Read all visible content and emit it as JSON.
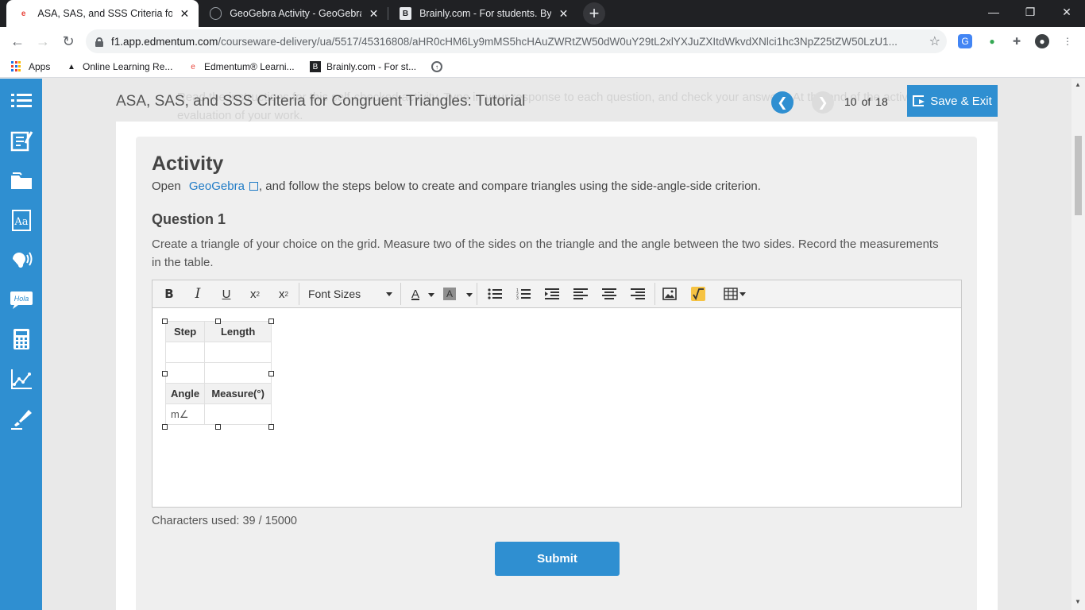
{
  "browser": {
    "tabs": [
      {
        "title": "ASA, SAS, and SSS Criteria for Co",
        "favicon": "e"
      },
      {
        "title": "GeoGebra Activity - GeoGebra Dy",
        "favicon": "g"
      },
      {
        "title": "Brainly.com - For students. By stu",
        "favicon": "B"
      }
    ],
    "url_domain": "f1.app.edmentum.com",
    "url_path": "/courseware-delivery/ua/5517/45316808/aHR0cHM6Ly9mMS5hcHAuZWRtZW50dW0uY29tL2xlYXJuZXItdWkvdXNlci1hc3NpZ25tZW50LzU1...",
    "bookmarks": [
      "Apps",
      "Online Learning Re...",
      "Edmentum® Learni...",
      "Brainly.com - For st..."
    ]
  },
  "header": {
    "lesson_title": "ASA, SAS, and SSS Criteria for Congruent Triangles: Tutorial",
    "ghost_text": "Read the instructions for this self-checked activity. Type in your response to each question, and check your answers. At the end of the activity, write a brief evaluation of your work.",
    "page_current": "10",
    "page_of": "of",
    "page_total": "18",
    "save_exit": "Save & Exit"
  },
  "activity": {
    "heading": "Activity",
    "intro_before": "Open",
    "intro_link": "GeoGebra",
    "intro_after": ", and follow the steps below to create and compare triangles using the side-angle-side criterion.",
    "question_heading": "Question 1",
    "prompt": "Create a triangle of your choice on the grid. Measure two of the sides on the triangle and the angle between the two sides. Record the measurements in the table."
  },
  "editor": {
    "font_sizes": "Font Sizes",
    "table": {
      "side_headers": [
        "Step",
        "Length"
      ],
      "angle_headers": [
        "Angle",
        "Measure(°)"
      ],
      "angle_prefix": "m∠"
    },
    "chars_used": "Characters used: 39 / 15000"
  },
  "submit_label": "Submit",
  "colors": {
    "accent": "#2f8fd1",
    "link": "#1f7bc6"
  }
}
